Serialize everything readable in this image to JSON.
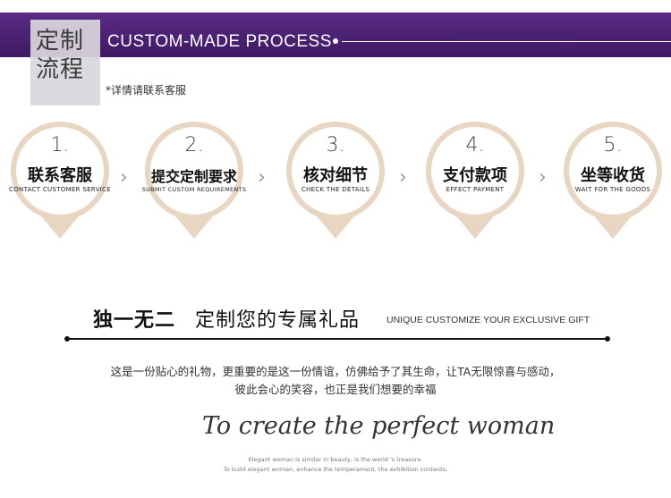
{
  "header": {
    "title_cn": "定制流程",
    "title_en": "CUSTOM-MADE PROCESS",
    "note": "*详情请联系客服",
    "banner_color": "#4a2173"
  },
  "steps": [
    {
      "num": "1.",
      "cn": "联系客服",
      "en": "CONTACT CUSTOMER SERVICE"
    },
    {
      "num": "2.",
      "cn": "提交定制要求",
      "en": "SUBMIT CUSTOM REQUIREMENTS"
    },
    {
      "num": "3.",
      "cn": "核对细节",
      "en": "CHECK THE DETAILS"
    },
    {
      "num": "4.",
      "cn": "支付款项",
      "en": "EFFECT PAYMENT"
    },
    {
      "num": "5.",
      "cn": "坐等收货",
      "en": "WAIT FOR THE GOODS"
    }
  ],
  "step_ring_color": "#e6d2bd",
  "slogan": {
    "cn_bold": "独一无二",
    "cn_rest": "定制您的专属礼品",
    "en": "UNIQUE CUSTOMIZE YOUR EXCLUSIVE GIFT"
  },
  "paragraph": {
    "line1": "这是一份贴心的礼物，更重要的是这一份情谊，仿佛给予了其生命，让TA无限惊喜与感动，",
    "line2": "彼此会心的笑容，也正是我们想要的幸福"
  },
  "footer": {
    "script": "To create the perfect woman",
    "fine1": "Elegant woman is similar in beauty, is the world 's treasure.",
    "fine2": "To build elegant woman, enhance the temperament, the exhibition contents,"
  }
}
